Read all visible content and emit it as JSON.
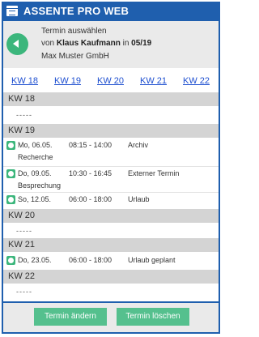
{
  "header": {
    "title": "ASSENTE PRO WEB",
    "logo_icon": "calendar-icon"
  },
  "info": {
    "line1": "Termin auswählen",
    "von_prefix": "von",
    "person": "Klaus Kaufmann",
    "in_word": "in",
    "period": "05/19",
    "company": "Max Muster GmbH"
  },
  "kw_nav": [
    "KW 18",
    "KW 19",
    "KW 20",
    "KW 21",
    "KW 22"
  ],
  "weeks": [
    {
      "label": "KW 18",
      "empty_text": "-----"
    },
    {
      "label": "KW 19"
    },
    {
      "label": "KW 20",
      "empty_text": "-----"
    },
    {
      "label": "KW 21"
    },
    {
      "label": "KW 22",
      "empty_text": "-----"
    }
  ],
  "entries": [
    {
      "date": "Mo, 06.05.",
      "time": "08:15 - 14:00",
      "type": "Archiv",
      "detail": "Recherche"
    },
    {
      "date": "Do, 09.05.",
      "time": "10:30 - 16:45",
      "type": "Externer Termin",
      "detail": "Besprechung"
    },
    {
      "date": "So, 12.05.",
      "time": "06:00 - 18:00",
      "type": "Urlaub",
      "detail": ""
    },
    {
      "date": "Do, 23.05.",
      "time": "06:00 - 18:00",
      "type": "Urlaub geplant",
      "detail": ""
    }
  ],
  "buttons": {
    "change": "Termin ändern",
    "delete": "Termin löschen"
  },
  "colors": {
    "brand": "#1f5fae",
    "accent": "#3cb67c",
    "button": "#55c08e",
    "link": "#1e4fd0"
  }
}
